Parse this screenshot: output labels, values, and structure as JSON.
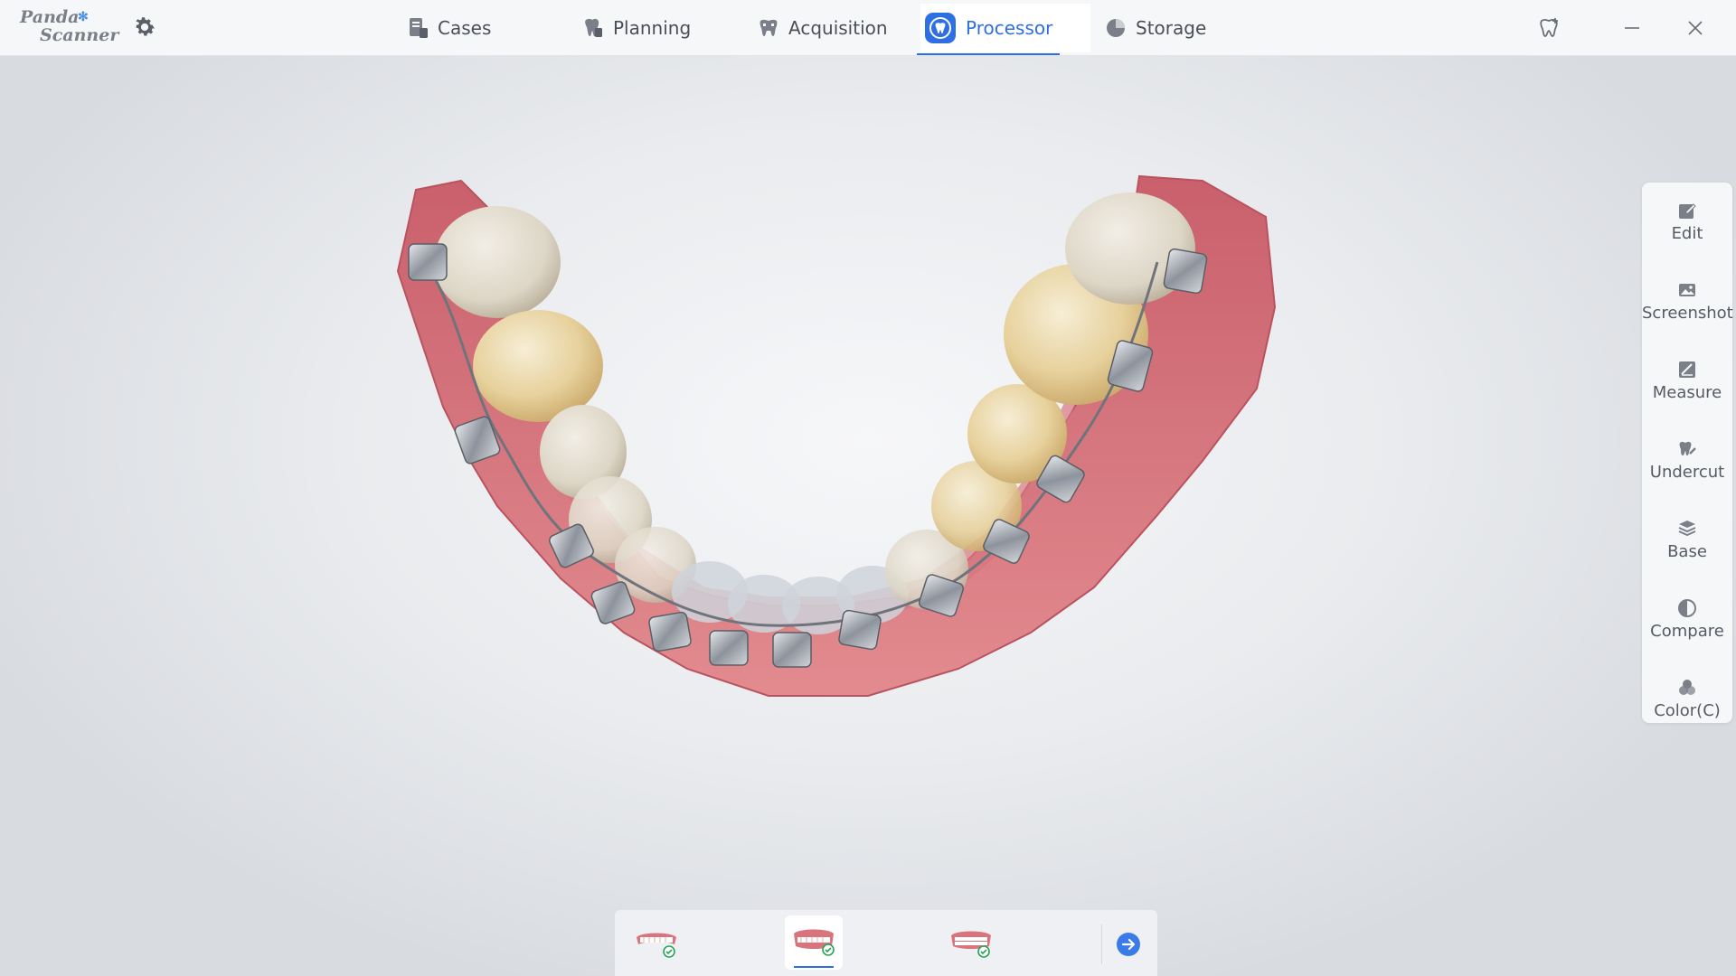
{
  "app": {
    "logo_line1": "Panda",
    "logo_line2": "Scanner",
    "logo_paw": "✻"
  },
  "nav": {
    "tabs": [
      {
        "label": "Cases",
        "icon": "cases-icon"
      },
      {
        "label": "Planning",
        "icon": "planning-icon"
      },
      {
        "label": "Acquisition",
        "icon": "acquisition-icon"
      },
      {
        "label": "Processor",
        "icon": "processor-icon",
        "active": true
      },
      {
        "label": "Storage",
        "icon": "storage-icon"
      }
    ]
  },
  "tools": [
    {
      "label": "Edit",
      "icon": "edit-icon"
    },
    {
      "label": "Screenshot",
      "icon": "screenshot-icon"
    },
    {
      "label": "Measure",
      "icon": "measure-icon"
    },
    {
      "label": "Undercut",
      "icon": "undercut-icon"
    },
    {
      "label": "Base",
      "icon": "base-icon"
    },
    {
      "label": "Compare",
      "icon": "compare-icon"
    },
    {
      "label": "Color(C)",
      "icon": "color-icon"
    }
  ],
  "bottom": {
    "arches": [
      {
        "name": "upper-arch",
        "done": true
      },
      {
        "name": "lower-arch",
        "done": true,
        "active": true
      },
      {
        "name": "bite",
        "done": true
      }
    ]
  },
  "colors": {
    "accent": "#2f6fe4",
    "check": "#27a35a",
    "gum": "#d9747c",
    "tooth": "#efe3c4"
  }
}
